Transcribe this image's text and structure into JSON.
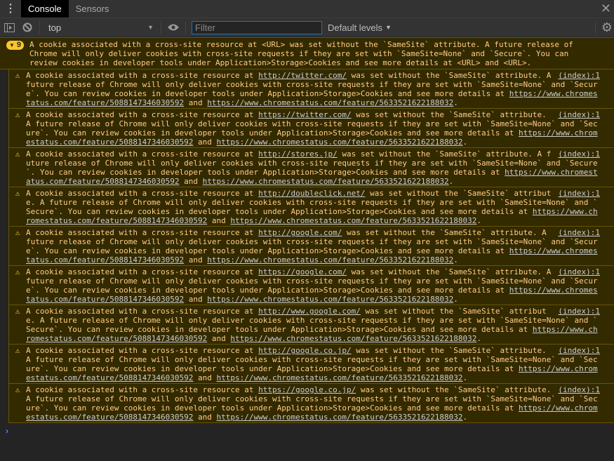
{
  "tabs": [
    {
      "label": "Console",
      "active": true
    },
    {
      "label": "Sensors",
      "active": false
    }
  ],
  "toolbar": {
    "context": "top",
    "filter_placeholder": "Filter",
    "filter_value": "",
    "levels": "Default levels"
  },
  "group": {
    "count": "9",
    "text": "A cookie associated with a cross-site resource at <URL> was set without the `SameSite` attribute. A future release of Chrome will only deliver cookies with cross-site requests if they are set with `SameSite=None` and `Secure`. You can review cookies in developer tools under Application>Storage>Cookies and see more details at <URL> and <URL>."
  },
  "messages": [
    {
      "url": "http://twitter.com/"
    },
    {
      "url": "https://twitter.com/"
    },
    {
      "url": "http://stores.jp/"
    },
    {
      "url": "http://doubleclick.net/"
    },
    {
      "url": "http://google.com/"
    },
    {
      "url": "https://google.com/"
    },
    {
      "url": "http://www.google.com/"
    },
    {
      "url": "http://google.co.jp/"
    },
    {
      "url": "https://google.co.jp/"
    }
  ],
  "message_parts": {
    "prefix": "A cookie associated with a cross-site resource at ",
    "middle": " was set without the `SameSite` attribute. A future release of Chrome will only deliver cookies with cross-site requests if they are set with `SameSite=None` and `Secure`. You can review cookies in developer tools under Application>Storage>Cookies and see more details at ",
    "link1": "https://www.chromestatus.com/feature/5088147346030592",
    "and": " and ",
    "link2": "https://www.chromestatus.com/feature/5633521622188032",
    "suffix": ".",
    "source": "(index):1"
  }
}
